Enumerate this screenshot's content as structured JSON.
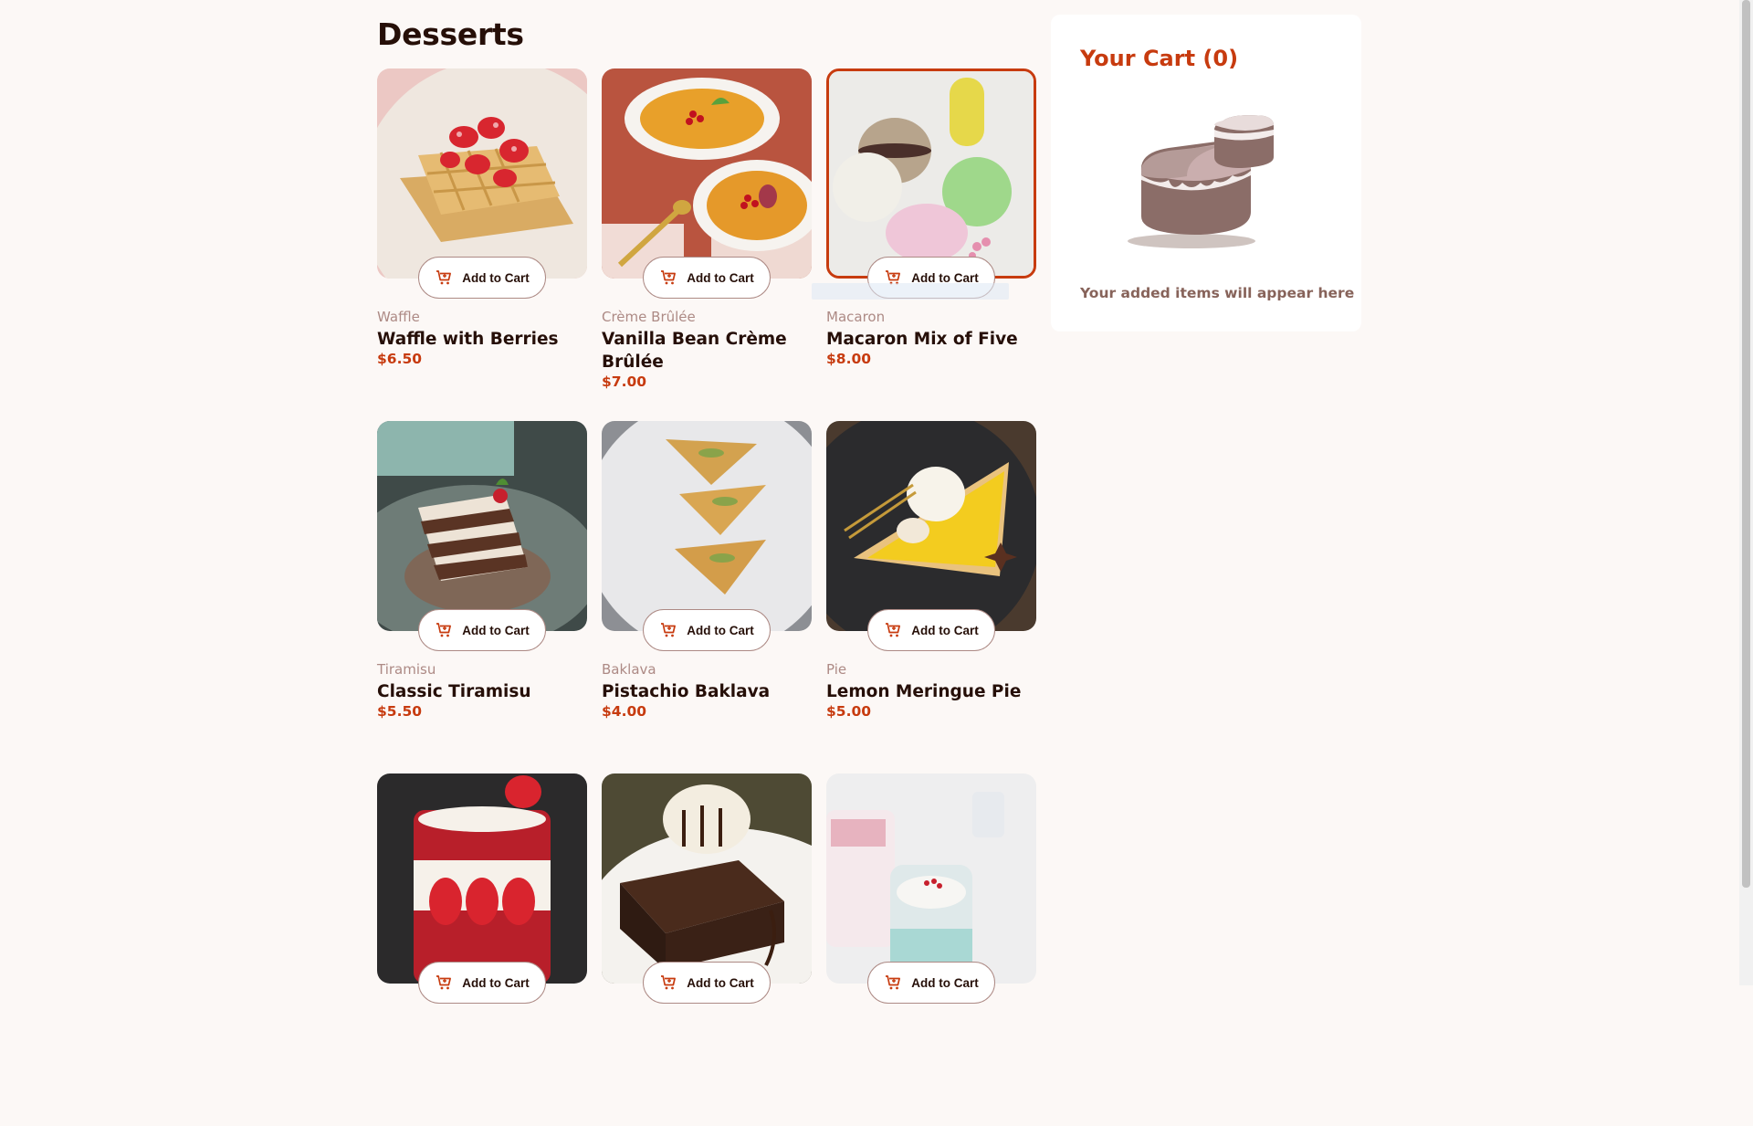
{
  "page": {
    "title": "Desserts"
  },
  "add_to_cart_label": "Add to Cart",
  "products": [
    {
      "category": "Waffle",
      "name": "Waffle with Berries",
      "price": "$6.50"
    },
    {
      "category": "Crème Brûlée",
      "name": "Vanilla Bean Crème Brûlée",
      "price": "$7.00"
    },
    {
      "category": "Macaron",
      "name": "Macaron Mix of Five",
      "price": "$8.00",
      "selected": true
    },
    {
      "category": "Tiramisu",
      "name": "Classic Tiramisu",
      "price": "$5.50"
    },
    {
      "category": "Baklava",
      "name": "Pistachio Baklava",
      "price": "$4.00"
    },
    {
      "category": "Pie",
      "name": "Lemon Meringue Pie",
      "price": "$5.00"
    }
  ],
  "cart": {
    "title": "Your Cart (0)",
    "empty_message": "Your added items will appear here",
    "illustration": "empty-cart-cake-icon"
  },
  "icons": {
    "add_to_cart": "add-to-cart-icon"
  },
  "colors": {
    "accent": "#c73b0f",
    "background": "#fcf8f6",
    "text_dark": "#260f08",
    "text_muted": "#ad8a85"
  }
}
